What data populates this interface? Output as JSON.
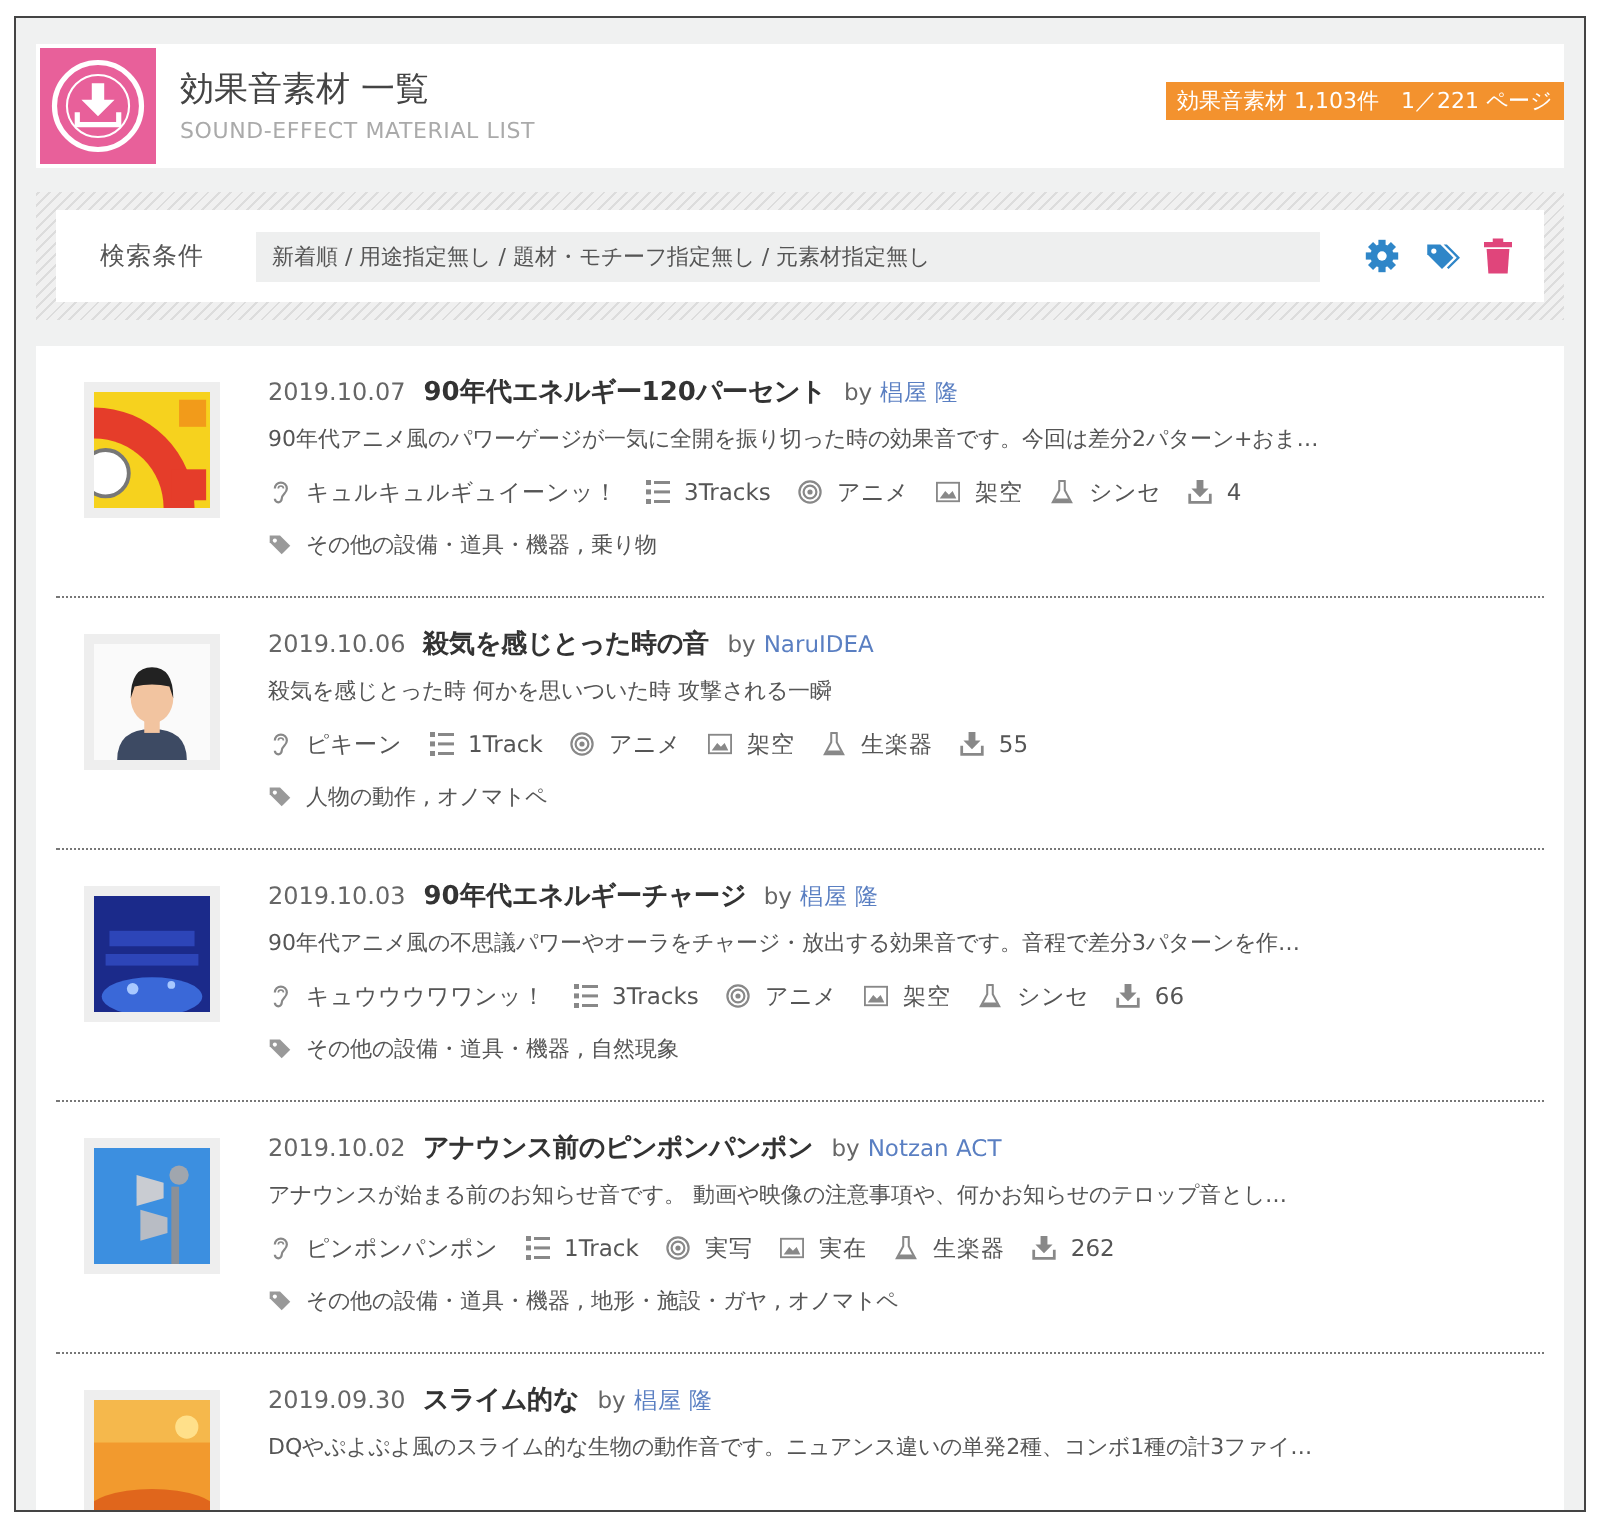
{
  "header": {
    "title": "効果音素材 一覧",
    "subtitle": "SOUND-EFFECT MATERIAL LIST",
    "badge": "効果音素材 1,103件　1／221 ページ"
  },
  "search": {
    "label": "検索条件",
    "value": "新着順 / 用途指定無し / 題材・モチーフ指定無し / 元素材指定無し"
  },
  "items": [
    {
      "date": "2019.10.07",
      "title": "90年代エネルギー120パーセント",
      "by": "by",
      "author": "椙屋 隆",
      "description": "90年代アニメ風のパワーゲージが一気に全開を振り切った時の効果音です。今回は差分2パターン+おま…",
      "meta": [
        {
          "kind": "sound",
          "text": "キュルキュルギュイーンッ！"
        },
        {
          "kind": "tracks",
          "text": "3Tracks"
        },
        {
          "kind": "style",
          "text": "アニメ"
        },
        {
          "kind": "world",
          "text": "架空"
        },
        {
          "kind": "source",
          "text": "シンセ"
        },
        {
          "kind": "downloads",
          "text": "4"
        }
      ],
      "tags": "その他の設備・道具・機器 , 乗り物"
    },
    {
      "date": "2019.10.06",
      "title": "殺気を感じとった時の音",
      "by": "by",
      "author": "NaruIDEA",
      "description": "殺気を感じとった時 何かを思いついた時 攻撃される一瞬",
      "meta": [
        {
          "kind": "sound",
          "text": "ピキーン"
        },
        {
          "kind": "tracks",
          "text": "1Track"
        },
        {
          "kind": "style",
          "text": "アニメ"
        },
        {
          "kind": "world",
          "text": "架空"
        },
        {
          "kind": "source",
          "text": "生楽器"
        },
        {
          "kind": "downloads",
          "text": "55"
        }
      ],
      "tags": "人物の動作 , オノマトペ"
    },
    {
      "date": "2019.10.03",
      "title": "90年代エネルギーチャージ",
      "by": "by",
      "author": "椙屋 隆",
      "description": "90年代アニメ風の不思議パワーやオーラをチャージ・放出する効果音です。音程で差分3パターンを作…",
      "meta": [
        {
          "kind": "sound",
          "text": "キュウウウワワンッ！"
        },
        {
          "kind": "tracks",
          "text": "3Tracks"
        },
        {
          "kind": "style",
          "text": "アニメ"
        },
        {
          "kind": "world",
          "text": "架空"
        },
        {
          "kind": "source",
          "text": "シンセ"
        },
        {
          "kind": "downloads",
          "text": "66"
        }
      ],
      "tags": "その他の設備・道具・機器 , 自然現象"
    },
    {
      "date": "2019.10.02",
      "title": "アナウンス前のピンポンパンポン",
      "by": "by",
      "author": "Notzan ACT",
      "description": "アナウンスが始まる前のお知らせ音です。 動画や映像の注意事項や、何かお知らせのテロップ音とし…",
      "meta": [
        {
          "kind": "sound",
          "text": "ピンポンパンポン"
        },
        {
          "kind": "tracks",
          "text": "1Track"
        },
        {
          "kind": "style",
          "text": "実写"
        },
        {
          "kind": "world",
          "text": "実在"
        },
        {
          "kind": "source",
          "text": "生楽器"
        },
        {
          "kind": "downloads",
          "text": "262"
        }
      ],
      "tags": "その他の設備・道具・機器 , 地形・施設・ガヤ , オノマトペ"
    },
    {
      "date": "2019.09.30",
      "title": "スライム的な",
      "by": "by",
      "author": "椙屋 隆",
      "description": "DQやぷよぷよ風のスライム的な生物の動作音です。ニュアンス違いの単発2種、コンボ1種の計3ファイ…"
    }
  ]
}
